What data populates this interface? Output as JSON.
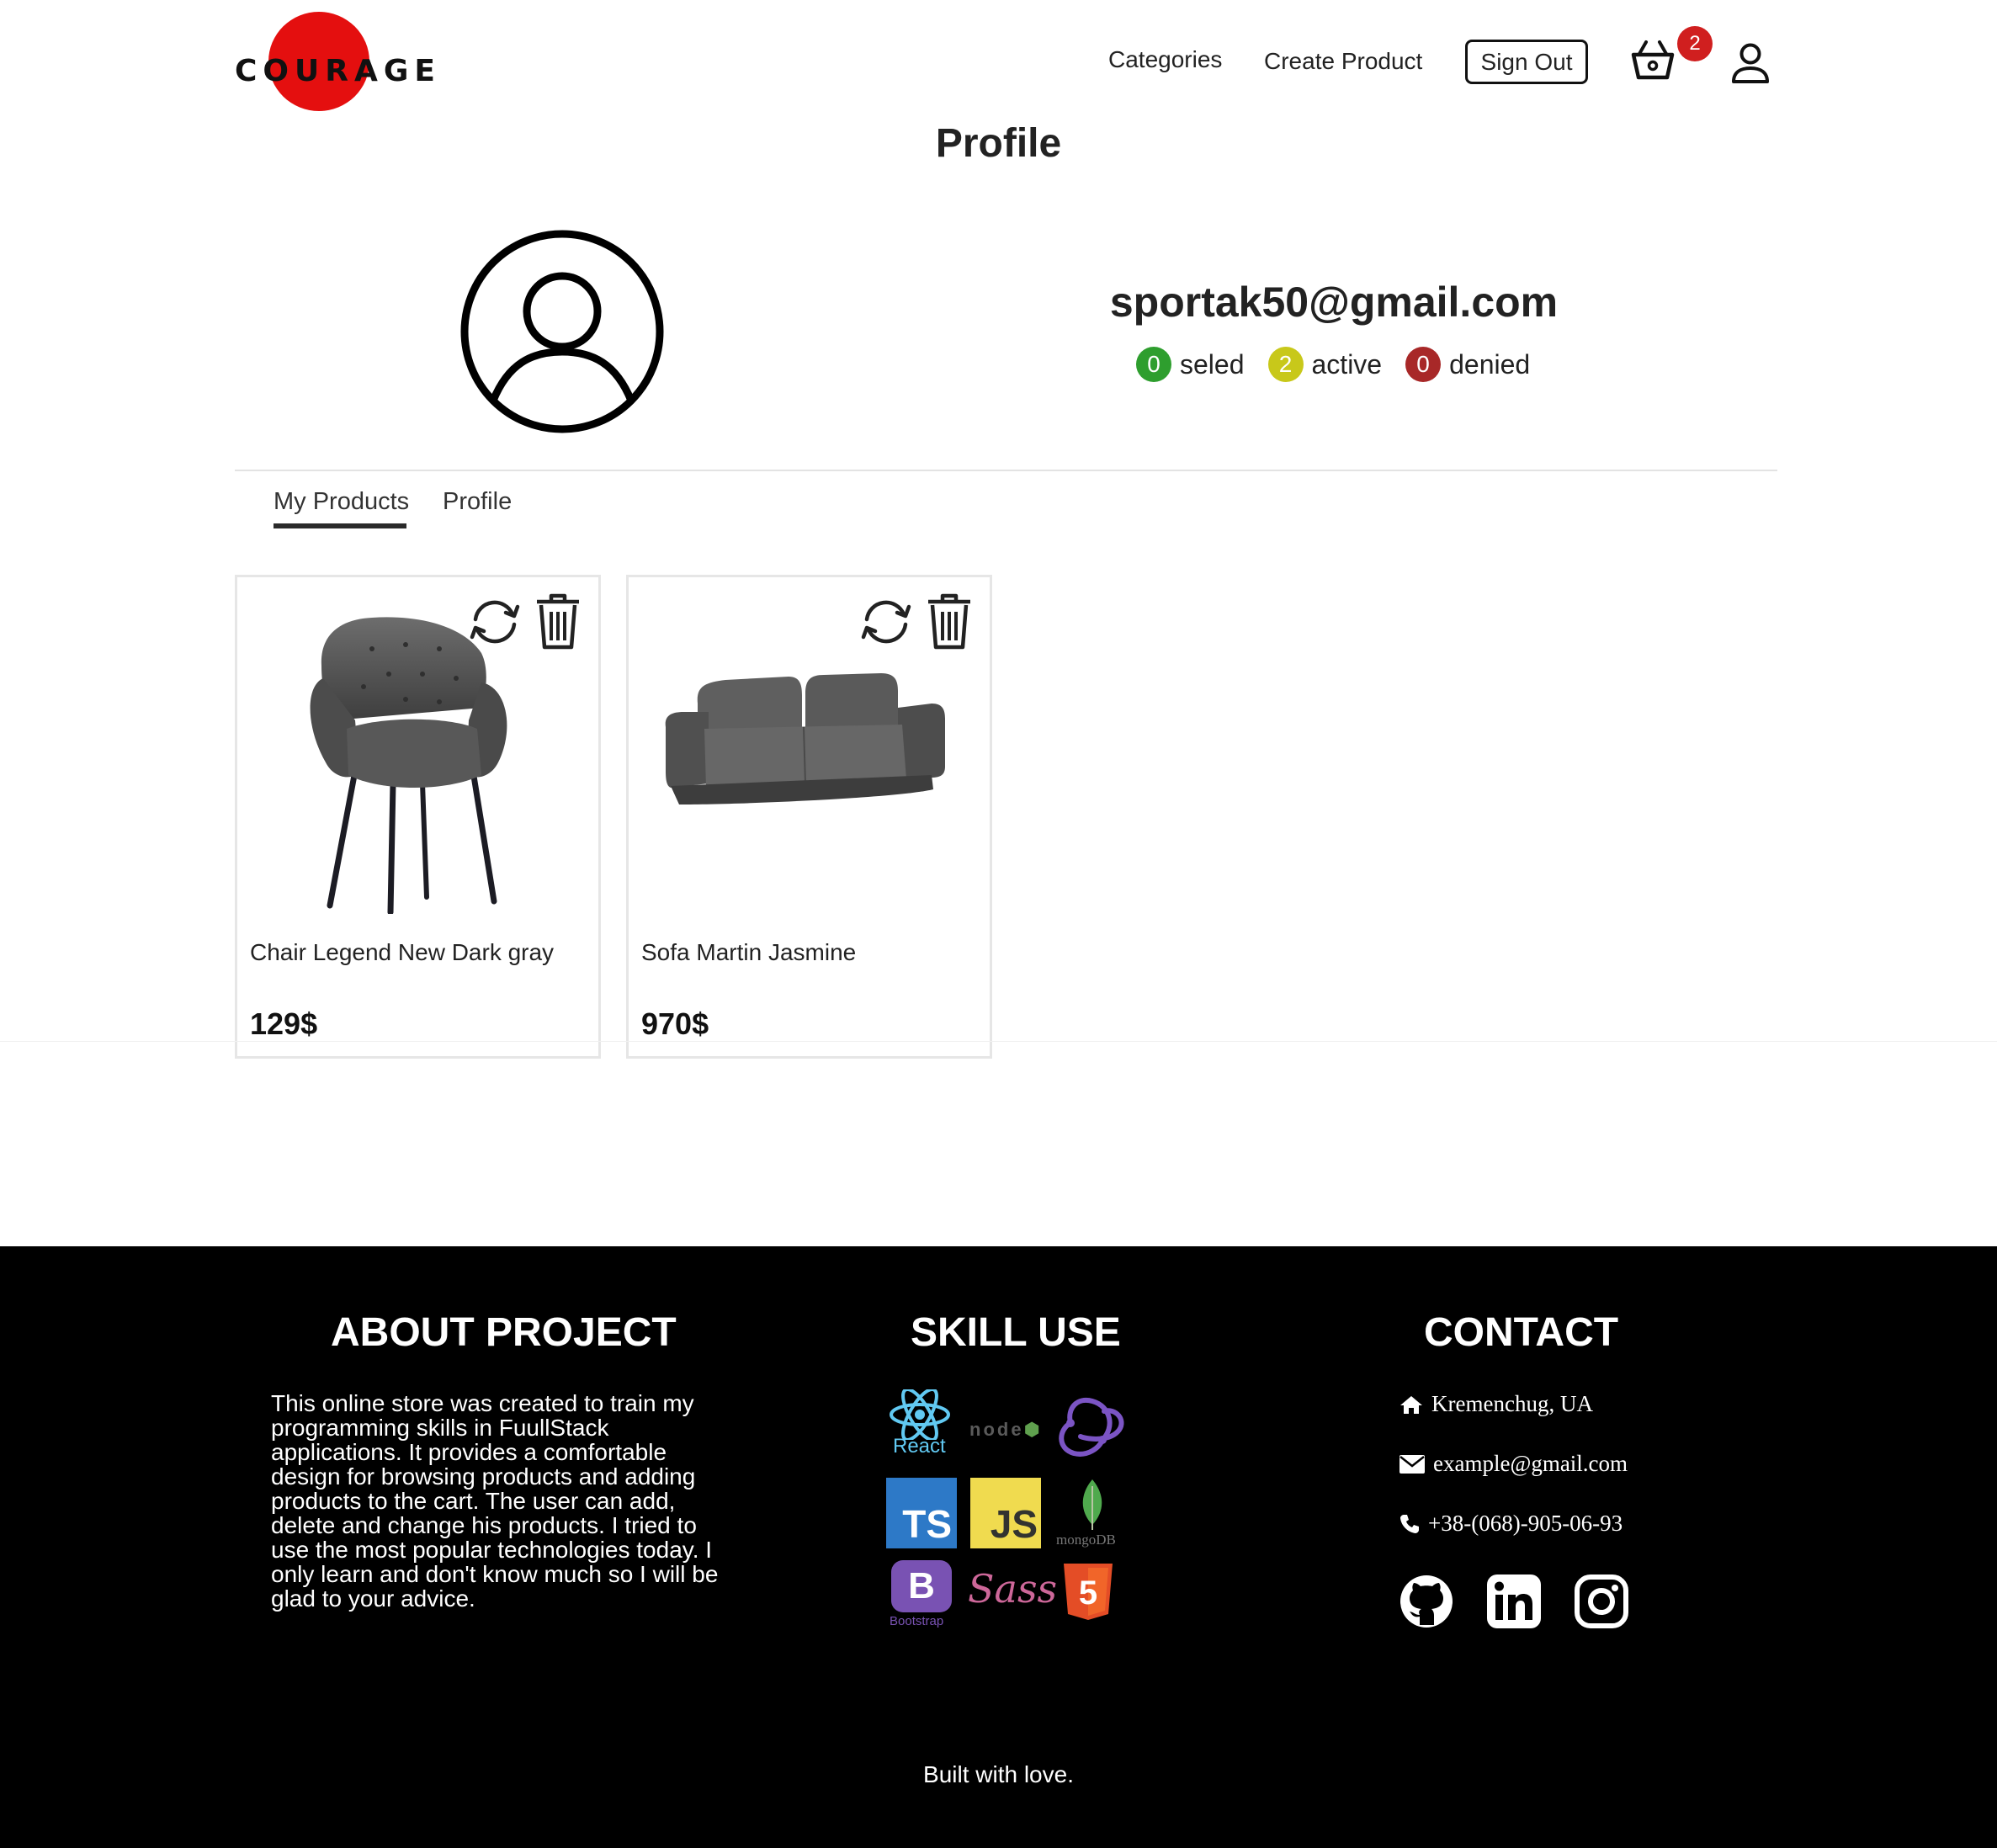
{
  "header": {
    "logo_text": "COURAGE",
    "nav": {
      "categories": "Categories",
      "create_product": "Create Product",
      "sign_out": "Sign Out"
    },
    "cart_count": "2"
  },
  "page": {
    "title": "Profile"
  },
  "profile": {
    "email": "sportak50@gmail.com",
    "stats": [
      {
        "count": "0",
        "label": "seled",
        "color": "#2e9e2e"
      },
      {
        "count": "2",
        "label": "active",
        "color": "#c8c81a"
      },
      {
        "count": "0",
        "label": "denied",
        "color": "#a82828"
      }
    ]
  },
  "tabs": [
    {
      "label": "My Products",
      "active": true
    },
    {
      "label": "Profile",
      "active": false
    }
  ],
  "products": [
    {
      "name": "Chair Legend New Dark gray",
      "price": "129$"
    },
    {
      "name": "Sofa Martin Jasmine",
      "price": "970$"
    }
  ],
  "footer": {
    "about": {
      "heading": "ABOUT PROJECT",
      "text": "This online store was created to train my programming skills in FuullStack applications. It provides a comfortable design for browsing products and adding products to the cart. The user can add, delete and change his products. I tried to use the most popular technologies today. I only learn and don't know much so I will be glad to your advice."
    },
    "skills": {
      "heading": "SKILL USE",
      "items": [
        {
          "icon": "react-icon",
          "label": "React"
        },
        {
          "icon": "nodejs-icon",
          "label": "node"
        },
        {
          "icon": "redux-icon",
          "label": ""
        },
        {
          "icon": "typescript-icon",
          "label": "TS"
        },
        {
          "icon": "javascript-icon",
          "label": "JS"
        },
        {
          "icon": "mongodb-icon",
          "label": "mongoDB"
        },
        {
          "icon": "bootstrap-icon",
          "label": "Bootstrap"
        },
        {
          "icon": "sass-icon",
          "label": "Sass"
        },
        {
          "icon": "html5-icon",
          "label": "5"
        }
      ]
    },
    "contact": {
      "heading": "CONTACT",
      "location": "Kremenchug, UA",
      "email": "example@gmail.com",
      "phone": "+38-(068)-905-06-93"
    },
    "built": "Built with love."
  }
}
